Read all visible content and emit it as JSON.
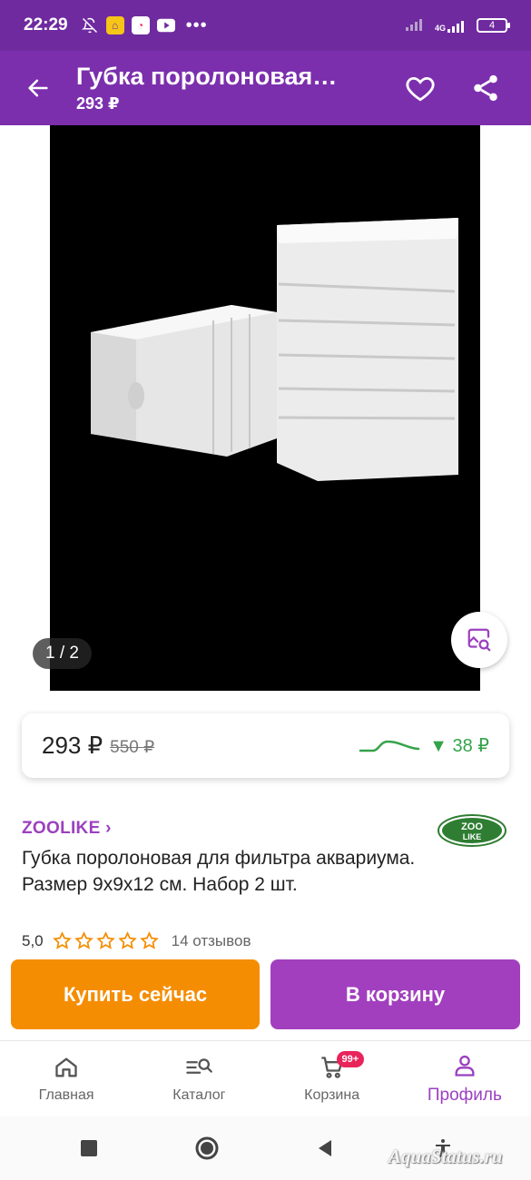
{
  "status_bar": {
    "time": "22:29",
    "network": "4G",
    "battery": "4"
  },
  "app_bar": {
    "title": "Губка поролоновая…",
    "price": "293 ₽"
  },
  "gallery": {
    "pager": "1 / 2"
  },
  "price_card": {
    "current": "293 ₽",
    "old": "550 ₽",
    "drop": "▼ 38 ₽"
  },
  "product": {
    "brand": "ZOOLIKE ›",
    "brand_logo_text": "ZOO LIKE",
    "title": "Губка поролоновая для фильтра аквариума. Размер 9x9x12 см. Набор 2 шт.",
    "rating": "5,0",
    "stars": 5,
    "reviews": "14 отзывов"
  },
  "actions": {
    "buy_now": "Купить сейчас",
    "add_to_cart": "В корзину"
  },
  "bottom_nav": {
    "home": "Главная",
    "catalog": "Каталог",
    "cart": "Корзина",
    "cart_badge": "99+",
    "profile": "Профиль"
  },
  "watermark": "AquaStatus.ru",
  "colors": {
    "status_bar": "#6f2a9f",
    "app_bar": "#7b2fad",
    "brand_accent": "#9b40c0",
    "buy_button": "#f58d02",
    "cart_button": "#a23fbe",
    "price_drop": "#35a34a",
    "star": "#f58d02"
  }
}
